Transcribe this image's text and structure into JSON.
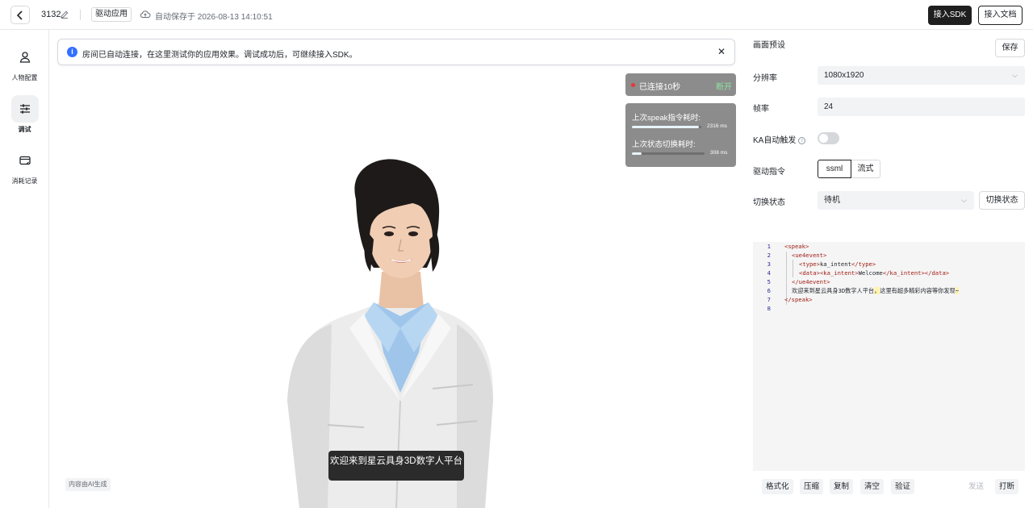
{
  "header": {
    "project_name": "3132",
    "app_tag": "驱动应用",
    "autosave": "自动保存于 2026-08-13 14:10:51",
    "sdk_button": "接入SDK",
    "docs_button": "接入文档"
  },
  "sidebar": {
    "items": [
      {
        "label": "人物配置",
        "icon": "person-icon"
      },
      {
        "label": "调试",
        "icon": "sliders-icon",
        "active": true
      },
      {
        "label": "消耗记录",
        "icon": "card-icon"
      }
    ]
  },
  "stage": {
    "banner_text": "房间已自动连接，在这里测试你的应用效果。调试成功后，可继续接入SDK。",
    "connection": {
      "status": "已连接10秒",
      "disconnect": "断开"
    },
    "stats": [
      {
        "label": "上次speak指令耗时:",
        "value": "2316 ms",
        "fill": 0.97
      },
      {
        "label": "上次状态切换耗时:",
        "value": "308 ms",
        "fill": 0.13
      }
    ],
    "subtitle": "欢迎来到星云具身3D数字人平台",
    "ai_note": "内容由AI生成"
  },
  "panel": {
    "title": "画面预设",
    "save": "保存",
    "resolution": {
      "label": "分辨率",
      "value": "1080x1920"
    },
    "fps": {
      "label": "帧率",
      "value": "24"
    },
    "ka": {
      "label": "KA自动触发",
      "enabled": false
    },
    "drive": {
      "label": "驱动指令",
      "options": [
        "ssml",
        "流式"
      ],
      "selected": "ssml"
    },
    "state": {
      "label": "切换状态",
      "value": "待机",
      "button": "切换状态"
    },
    "editor": {
      "line_numbers": [
        "1",
        "2",
        "3",
        "4",
        "5",
        "6",
        "7",
        "8"
      ],
      "l1": "<speak>",
      "l2": "<ue4event>",
      "l3_open": "<type>",
      "l3_text": "ka_intent",
      "l3_close": "</type>",
      "l4_open": "<data><ka_intent>",
      "l4_text": "Welcome",
      "l4_close": "</ka_intent></data>",
      "l5": "</ue4event>",
      "l6_a": "欢迎来到星云具身3D数字人平台",
      "l6_b": "，",
      "l6_c": "这里有超多精彩内容等你发现",
      "l6_d": "~",
      "l7": "</speak>"
    },
    "footer": {
      "format": "格式化",
      "compress": "压缩",
      "copy": "复制",
      "clear": "清空",
      "verify": "验证",
      "send": "发送",
      "interrupt": "打断"
    }
  }
}
